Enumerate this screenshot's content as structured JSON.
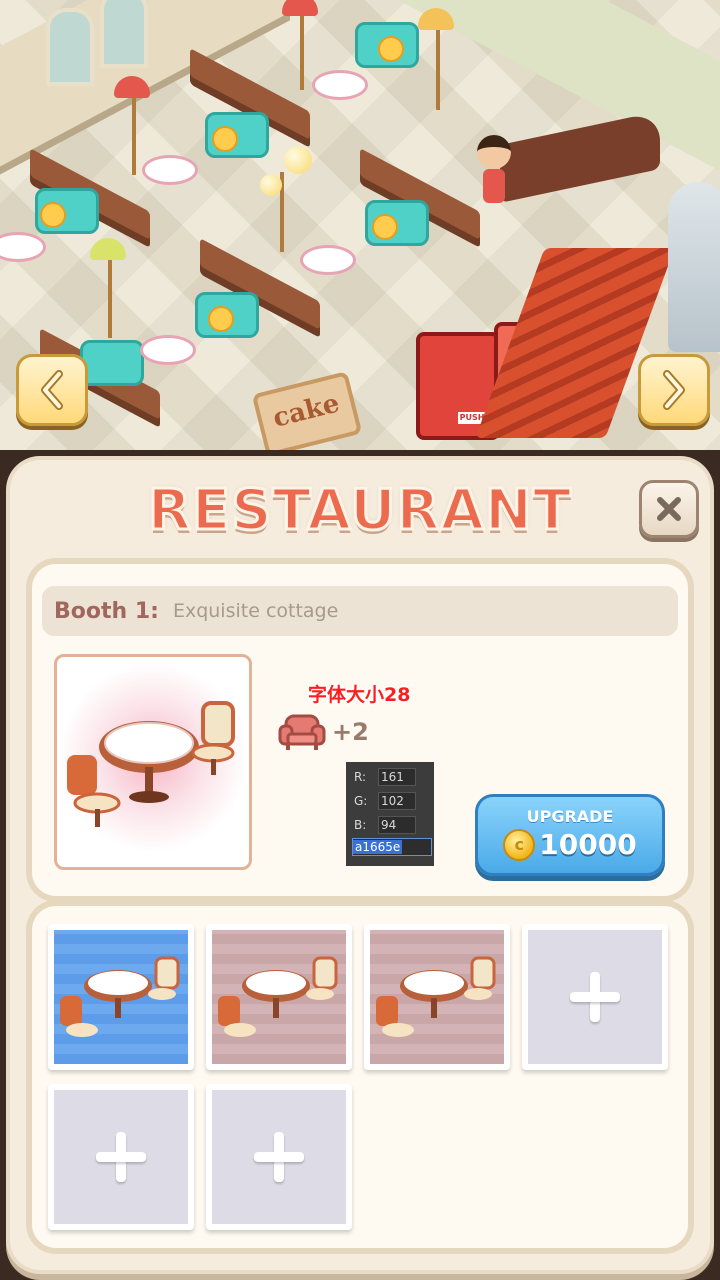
{
  "scene": {
    "sign_text": "cake",
    "vending_label": "PUSH",
    "nav": {
      "prev_icon": "chevron-left-icon",
      "next_icon": "chevron-right-icon"
    }
  },
  "panel": {
    "title": "RESTAURANT",
    "close_icon": "close-icon",
    "booth": {
      "label": "Booth 1:",
      "name": "Exquisite cottage"
    },
    "seat_bonus": {
      "icon": "sofa-icon",
      "value": "+2"
    },
    "note": "字体大小28",
    "color_picker": {
      "r_label": "R:",
      "r": "161",
      "g_label": "G:",
      "g": "102",
      "b_label": "B:",
      "b": "94",
      "hex": "a1665e"
    },
    "upgrade": {
      "label": "UPGRADE",
      "coin_icon": "coin-icon",
      "coin_glyph": "c",
      "price": "10000"
    },
    "slots": [
      {
        "kind": "skin",
        "theme": "blue"
      },
      {
        "kind": "skin",
        "theme": "pink"
      },
      {
        "kind": "skin",
        "theme": "pink"
      },
      {
        "kind": "empty",
        "icon": "plus-icon"
      },
      {
        "kind": "empty",
        "icon": "plus-icon"
      },
      {
        "kind": "empty",
        "icon": "plus-icon"
      }
    ]
  },
  "colors": {
    "title": "#ec6b4f",
    "booth_label": "#a1665e",
    "upgrade_button": "#4aaae8",
    "note": "#ff1e1e"
  }
}
